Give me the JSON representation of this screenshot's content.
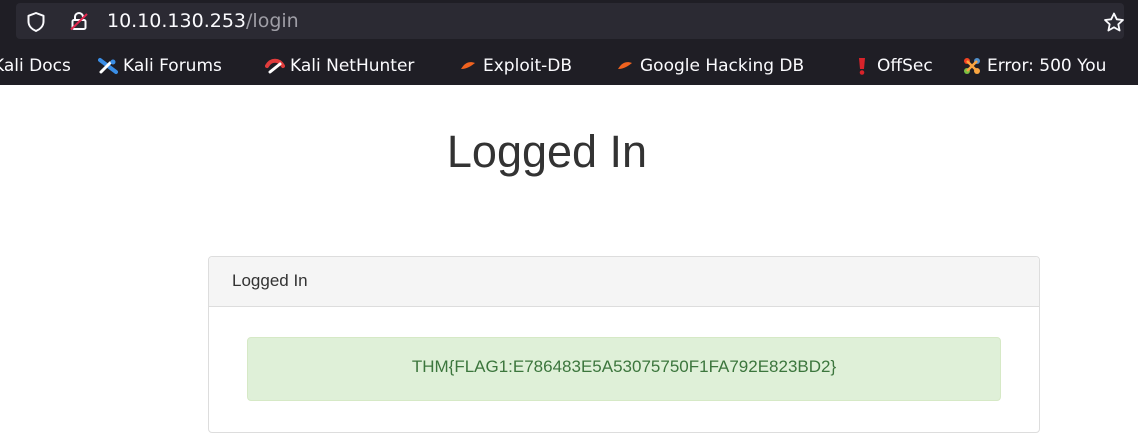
{
  "browser": {
    "url_host": "10.10.130.253",
    "url_path": "/login",
    "bookmarks": [
      {
        "label": "Kali Docs",
        "icon": "kali-docs-icon"
      },
      {
        "label": "Kali Forums",
        "icon": "kali-forums-icon"
      },
      {
        "label": "Kali NetHunter",
        "icon": "kali-nethunter-icon"
      },
      {
        "label": "Exploit-DB",
        "icon": "exploit-db-icon"
      },
      {
        "label": "Google Hacking DB",
        "icon": "google-hacking-db-icon"
      },
      {
        "label": "OffSec",
        "icon": "offsec-icon"
      },
      {
        "label": "Error: 500 You",
        "icon": "joomla-icon"
      }
    ]
  },
  "page": {
    "title": "Logged In",
    "panel_heading": "Logged In",
    "flag_message": "THM{FLAG1:E786483E5A53075750F1FA792E823BD2}"
  },
  "colors": {
    "chrome_bg": "#1f1e25",
    "urlbar_bg": "#2b2a33",
    "alert_bg": "#dff0d8",
    "alert_text": "#3c763d"
  }
}
